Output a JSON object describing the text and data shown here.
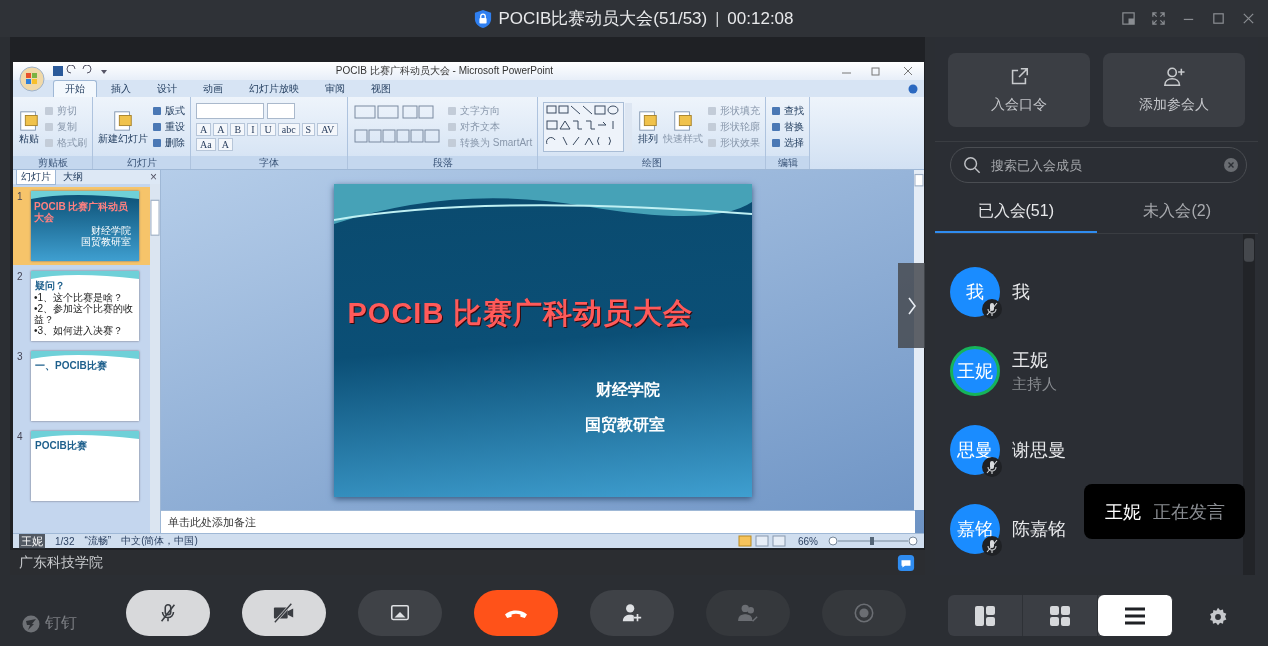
{
  "window": {
    "title": "POCIB比赛动员大会(51/53)",
    "separator": "|",
    "timer": "00:12:08"
  },
  "shared_screen": {
    "app_title": "POCIB 比赛广科动员大会 - Microsoft PowerPoint",
    "ribbon_tabs": [
      {
        "label": "开始",
        "selected": true
      },
      {
        "label": "插入",
        "selected": false
      },
      {
        "label": "设计",
        "selected": false
      },
      {
        "label": "动画",
        "selected": false
      },
      {
        "label": "幻灯片放映",
        "selected": false
      },
      {
        "label": "审阅",
        "selected": false
      },
      {
        "label": "视图",
        "selected": false
      }
    ],
    "ribbon_groups": [
      {
        "label": "剪贴板",
        "kind": "tools",
        "items": [
          {
            "label": "粘贴",
            "kind": "large",
            "disabled": false
          },
          {
            "label": "剪切",
            "kind": "small",
            "disabled": true
          },
          {
            "label": "复制",
            "kind": "small",
            "disabled": true
          },
          {
            "label": "格式刷",
            "kind": "small",
            "disabled": true
          }
        ]
      },
      {
        "label": "幻灯片",
        "kind": "tools",
        "items": [
          {
            "label": "新建幻灯片",
            "kind": "large",
            "disabled": false
          },
          {
            "label": "版式",
            "kind": "small",
            "disabled": false
          },
          {
            "label": "重设",
            "kind": "small",
            "disabled": false
          },
          {
            "label": "删除",
            "kind": "small",
            "disabled": false
          }
        ]
      },
      {
        "label": "字体",
        "kind": "font",
        "glyphs": [
          "A",
          "A",
          "B",
          "I",
          "U",
          "abc",
          "S",
          "AV",
          "Aa",
          "A"
        ]
      },
      {
        "label": "段落",
        "kind": "paragraph",
        "items": [
          {
            "label": "文字方向",
            "kind": "small",
            "disabled": true
          },
          {
            "label": "对齐文本",
            "kind": "small",
            "disabled": true
          },
          {
            "label": "转换为 SmartArt",
            "kind": "small",
            "disabled": true
          }
        ]
      },
      {
        "label": "绘图",
        "kind": "drawing",
        "items": [
          {
            "label": "排列",
            "kind": "large",
            "disabled": false
          },
          {
            "label": "快速样式",
            "kind": "large",
            "disabled": true
          },
          {
            "label": "形状填充",
            "kind": "small",
            "disabled": true
          },
          {
            "label": "形状轮廓",
            "kind": "small",
            "disabled": true
          },
          {
            "label": "形状效果",
            "kind": "small",
            "disabled": true
          }
        ]
      },
      {
        "label": "编辑",
        "kind": "tools",
        "items": [
          {
            "label": "查找",
            "kind": "small",
            "disabled": false
          },
          {
            "label": "替换",
            "kind": "small",
            "disabled": false
          },
          {
            "label": "选择",
            "kind": "small",
            "disabled": false
          }
        ]
      }
    ],
    "pane_tabs": [
      {
        "label": "幻灯片",
        "selected": true
      },
      {
        "label": "大纲",
        "selected": false
      }
    ],
    "pane_close": "×",
    "thumbnails": [
      {
        "number": "1",
        "selected": true,
        "kind": "title",
        "title": "POCIB 比赛广科动员大会",
        "lines": [
          "财经学院",
          "国贸教研室"
        ]
      },
      {
        "number": "2",
        "selected": false,
        "kind": "content",
        "title": "疑问？",
        "lines": [
          "•1、这个比赛是啥？",
          "•2、参加这个比赛的收益？",
          "•3、如何进入决赛？"
        ]
      },
      {
        "number": "3",
        "selected": false,
        "kind": "content",
        "title": "一、POCIB比赛"
      },
      {
        "number": "4",
        "selected": false,
        "kind": "content",
        "title": "POCIB比赛"
      }
    ],
    "slide": {
      "title": "POCIB 比赛广科动员大会",
      "lines": [
        "财经学院",
        "国贸教研室"
      ]
    },
    "notes_placeholder": "单击此处添加备注",
    "overlay_name": "王妮",
    "status_items": [
      "1/32",
      "“流畅”",
      "中文(简体，中国)"
    ],
    "zoom": "66%"
  },
  "sharer": "广东科技学院",
  "panel": {
    "actions": [
      {
        "kind": "share-link",
        "label": "入会口令"
      },
      {
        "kind": "add-person",
        "label": "添加参会人"
      }
    ],
    "search": {
      "placeholder": "搜索已入会成员"
    },
    "tabs": [
      {
        "label": "已入会(51)",
        "selected": true
      },
      {
        "label": "未入会(2)",
        "selected": false
      }
    ],
    "members": [
      {
        "avatar": "我",
        "name": "我",
        "muted": true,
        "speaking": false
      },
      {
        "avatar": "王妮",
        "name": "王妮",
        "role": "主持人",
        "muted": false,
        "speaking": true
      },
      {
        "avatar": "思曼",
        "name": "谢思曼",
        "muted": true,
        "speaking": false
      },
      {
        "avatar": "嘉铭",
        "name": "陈嘉铭",
        "muted": true,
        "speaking": false
      }
    ],
    "speaking_toast": {
      "name": "王妮",
      "text": "正在发言"
    }
  },
  "brand": "钉钉",
  "controls": [
    {
      "kind": "mic",
      "muted": true,
      "disabled": false
    },
    {
      "kind": "camera",
      "muted": true,
      "disabled": false
    },
    {
      "kind": "share",
      "muted": false,
      "disabled": false
    },
    {
      "kind": "hangup",
      "muted": false,
      "disabled": false
    },
    {
      "kind": "invite",
      "muted": false,
      "disabled": false
    },
    {
      "kind": "manage",
      "muted": false,
      "disabled": true
    },
    {
      "kind": "record",
      "muted": false,
      "disabled": true
    }
  ],
  "layouts": [
    {
      "kind": "speaker",
      "selected": false
    },
    {
      "kind": "grid",
      "selected": false
    },
    {
      "kind": "list",
      "selected": true
    }
  ]
}
